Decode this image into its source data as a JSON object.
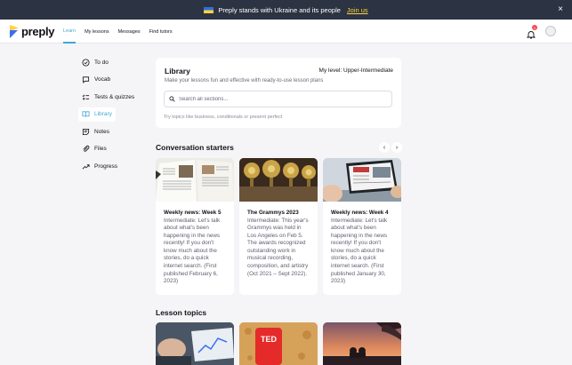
{
  "banner": {
    "text": "Preply stands with Ukraine and its people",
    "link": "Join us",
    "close": "×"
  },
  "nav": {
    "logo": "preply",
    "links": [
      "Learn",
      "My lessons",
      "Messages",
      "Find tutors"
    ],
    "notification_count": "1"
  },
  "sidebar": {
    "items": [
      {
        "label": "To do",
        "icon": "check-circle-icon"
      },
      {
        "label": "Vocab",
        "icon": "chat-bubble-icon"
      },
      {
        "label": "Tests & quizzes",
        "icon": "quiz-icon"
      },
      {
        "label": "Library",
        "icon": "book-icon"
      },
      {
        "label": "Notes",
        "icon": "notes-icon"
      },
      {
        "label": "Files",
        "icon": "paperclip-icon"
      },
      {
        "label": "Progress",
        "icon": "trend-arrow-icon"
      }
    ],
    "active_index": 3
  },
  "library": {
    "title": "Library",
    "level": "My level: Upper-Intermediate",
    "subtitle": "Make your lessons fun and effective with ready-to-use lesson plans",
    "search_placeholder": "Search all sections...",
    "hint": "Try topics like business, conditionals or present perfect"
  },
  "conversation": {
    "title": "Conversation starters",
    "cards": [
      {
        "title": "Weekly news: Week 5",
        "body": "Intermediate: Let's talk about what's been happening in the news recently! If you don't know much about the stories, do a quick internet search. (First published February 6, 2023)"
      },
      {
        "title": "The Grammys 2023",
        "body": "Intermediate: This year's Grammys was held in Los Angeles on Feb 5. The awards recognized outstanding work in musical recording, composition, and artistry (Oct 2021 – Sept 2022)."
      },
      {
        "title": "Weekly news: Week 4",
        "body": "Intermediate: Let's talk about what's been happening in the news recently! If you don't know much about the stories, do a quick internet search. (First published January 30, 2023)"
      }
    ]
  },
  "topics": {
    "title": "Lesson topics",
    "ted_label": "TED"
  }
}
